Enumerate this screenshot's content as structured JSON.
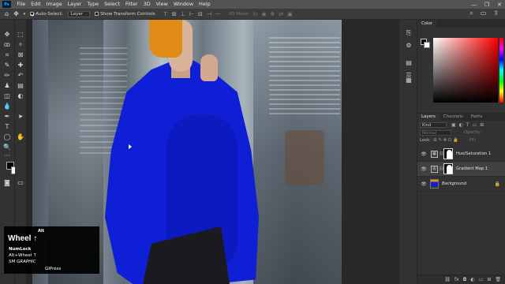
{
  "menubar": {
    "logo": "Ps",
    "items": [
      "File",
      "Edit",
      "Image",
      "Layer",
      "Type",
      "Select",
      "Filter",
      "3D",
      "View",
      "Window",
      "Help"
    ],
    "window_controls": [
      "—",
      "❐",
      "✕"
    ]
  },
  "options": {
    "tool_icon": "move-tool-icon",
    "auto_select_label": "Auto-Select:",
    "auto_select_checked": true,
    "auto_select_value": "Layer",
    "show_transform_label": "Show Transform Controls",
    "show_transform_checked": false,
    "mode_label": "3D Mode:"
  },
  "canvas": {
    "image_description_colors": {
      "sweater": "#0f1fd6",
      "hat": "#e08a18"
    }
  },
  "key_overlay": {
    "alt_top": "Alt",
    "wheel": "Wheel ↑",
    "numlock": "NumLock",
    "alt_wheel": "Alt+Wheel ↑",
    "brand": "SM GRAPHIC",
    "gipress": "GIPress"
  },
  "color_panel": {
    "tab": "Color"
  },
  "layers_panel": {
    "tabs": [
      "Layers",
      "Channels",
      "Paths"
    ],
    "filter_label": "Kind",
    "blend_mode": "Normal",
    "opacity_label": "Opacity:",
    "lock_label": "Lock:",
    "fill_label": "Fill:",
    "layers": [
      {
        "name": "Hue/Saturation 1",
        "type": "adjustment",
        "visible": true,
        "selected": false
      },
      {
        "name": "Gradient Map 1",
        "type": "adjustment",
        "visible": true,
        "selected": true
      },
      {
        "name": "Background",
        "type": "image",
        "visible": true,
        "selected": false,
        "locked": true
      }
    ]
  }
}
